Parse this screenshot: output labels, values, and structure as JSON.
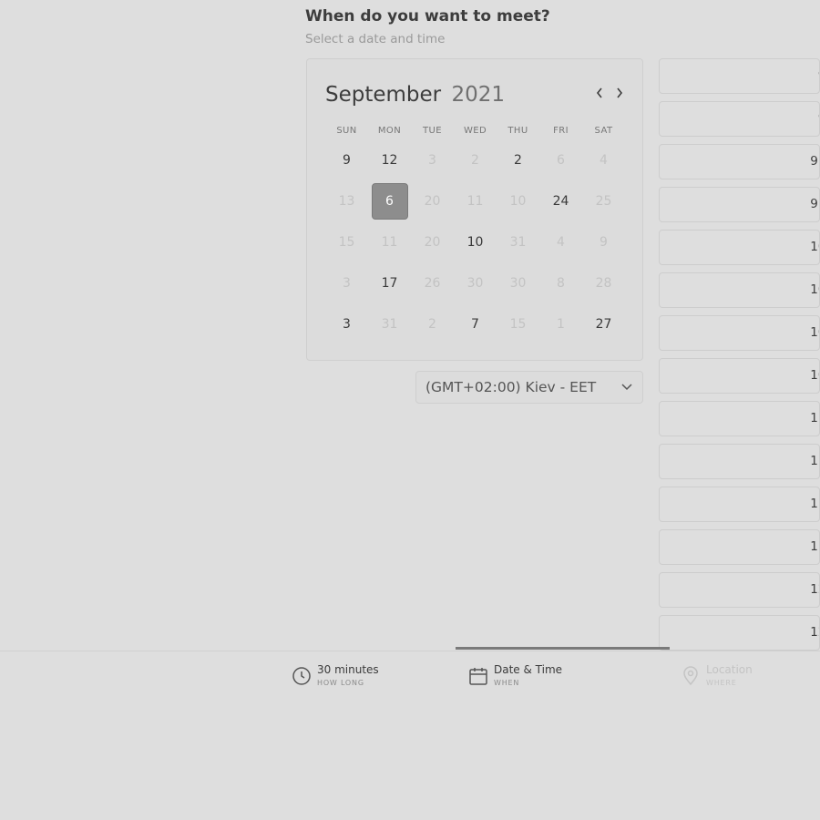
{
  "header": {
    "title": "When do you want to meet?",
    "subtitle": "Select a date and time"
  },
  "calendar": {
    "month": "September",
    "year": "2021",
    "prev_icon": "chevron-left-icon",
    "next_icon": "chevron-right-icon",
    "weekdays": [
      "SUN",
      "MON",
      "TUE",
      "WED",
      "THU",
      "FRI",
      "SAT"
    ],
    "weeks": [
      [
        {
          "d": "9",
          "a": true
        },
        {
          "d": "12",
          "a": true
        },
        {
          "d": "3",
          "a": false
        },
        {
          "d": "2",
          "a": false
        },
        {
          "d": "2",
          "a": true
        },
        {
          "d": "6",
          "a": false
        },
        {
          "d": "4",
          "a": false
        }
      ],
      [
        {
          "d": "13",
          "a": false
        },
        {
          "d": "6",
          "a": true,
          "sel": true
        },
        {
          "d": "20",
          "a": false
        },
        {
          "d": "11",
          "a": false
        },
        {
          "d": "10",
          "a": false
        },
        {
          "d": "24",
          "a": true
        },
        {
          "d": "25",
          "a": false
        }
      ],
      [
        {
          "d": "15",
          "a": false
        },
        {
          "d": "11",
          "a": false
        },
        {
          "d": "20",
          "a": false
        },
        {
          "d": "10",
          "a": true
        },
        {
          "d": "31",
          "a": false
        },
        {
          "d": "4",
          "a": false
        },
        {
          "d": "9",
          "a": false
        }
      ],
      [
        {
          "d": "3",
          "a": false
        },
        {
          "d": "17",
          "a": true
        },
        {
          "d": "26",
          "a": false
        },
        {
          "d": "30",
          "a": false
        },
        {
          "d": "30",
          "a": false
        },
        {
          "d": "8",
          "a": false
        },
        {
          "d": "28",
          "a": false
        }
      ],
      [
        {
          "d": "3",
          "a": true
        },
        {
          "d": "31",
          "a": false
        },
        {
          "d": "2",
          "a": false
        },
        {
          "d": "7",
          "a": true
        },
        {
          "d": "15",
          "a": false
        },
        {
          "d": "1",
          "a": false
        },
        {
          "d": "27",
          "a": true
        }
      ]
    ]
  },
  "timezone": {
    "label": "(GMT+02:00) Kiev - EET",
    "icon": "chevron-down-icon"
  },
  "time_slots": [
    "9:",
    "9:",
    "9:3",
    "9:4",
    "10:",
    "10:",
    "10:",
    "10:",
    "11:",
    "11:",
    "11:",
    "11:",
    "12:",
    "12:"
  ],
  "steps": {
    "duration": {
      "title": "30 minutes",
      "sub": "HOW LONG",
      "icon": "clock-icon"
    },
    "datetime": {
      "title": "Date & Time",
      "sub": "WHEN",
      "icon": "calendar-icon"
    },
    "location": {
      "title": "Location",
      "sub": "WHERE",
      "icon": "location-pin-icon"
    }
  },
  "colors": {
    "selected_day": "#8d8d8d",
    "progress": "#7a7a7a"
  }
}
